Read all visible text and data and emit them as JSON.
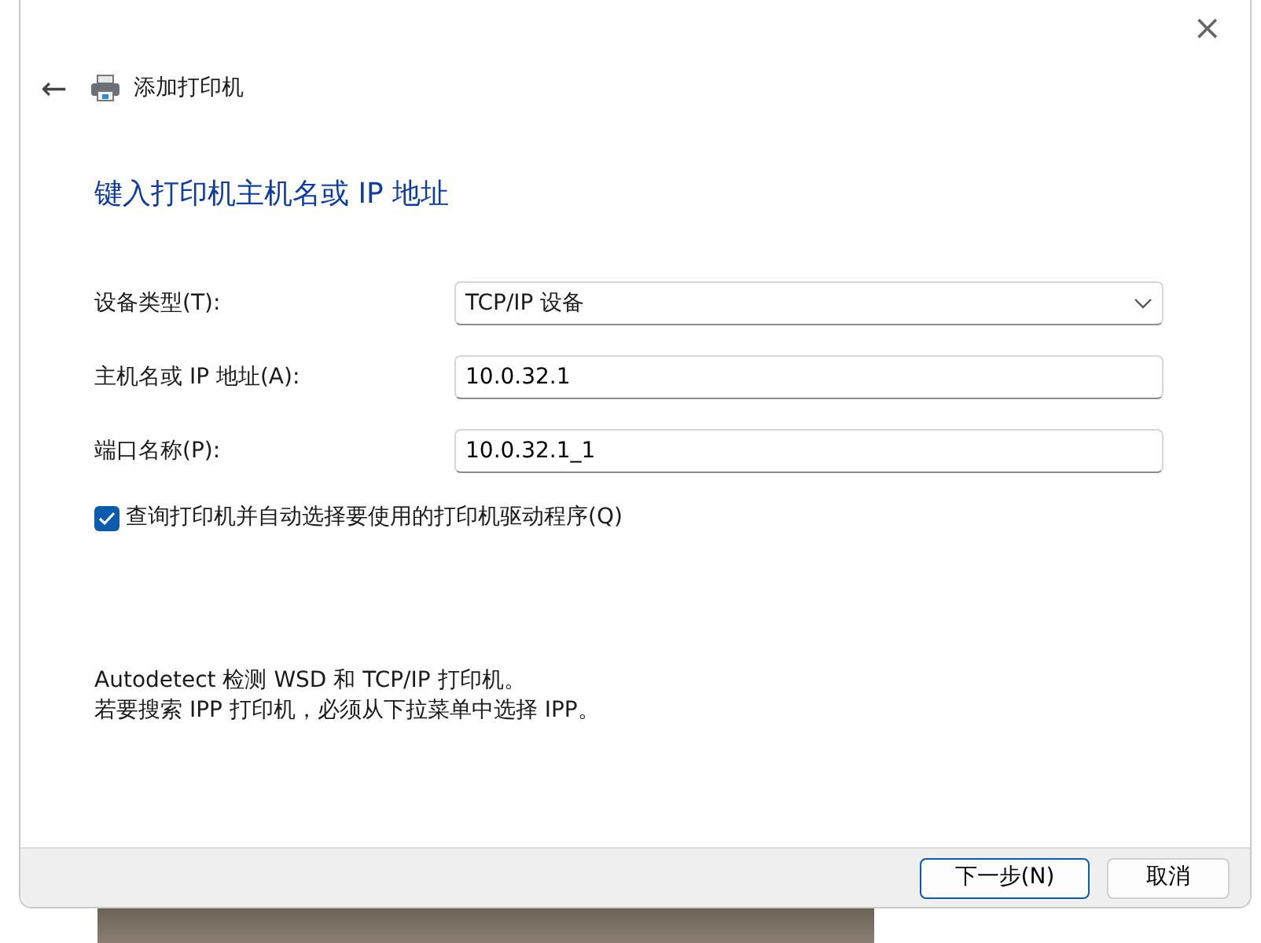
{
  "window": {
    "close": "×"
  },
  "header": {
    "back": "←",
    "title": "添加打印机"
  },
  "heading": "键入打印机主机名或 IP 地址",
  "fields": [
    {
      "kind": "select",
      "label": "设备类型(T):",
      "value": "TCP/IP 设备"
    },
    {
      "kind": "text",
      "label": "主机名或 IP 地址(A):",
      "value": "10.0.32.1"
    },
    {
      "kind": "text",
      "label": "端口名称(P):",
      "value": "10.0.32.1_1"
    }
  ],
  "query_driver": {
    "label": "查询打印机并自动选择要使用的打印机驱动程序(Q)",
    "checked": true
  },
  "info": [
    "Autodetect 检测 WSD 和 TCP/IP 打印机。",
    "若要搜索 IPP 打印机，必须从下拉菜单中选择 IPP。"
  ],
  "buttons": [
    {
      "label": "下一步(N)",
      "primary": true
    },
    {
      "label": "取消",
      "primary": false
    }
  ]
}
